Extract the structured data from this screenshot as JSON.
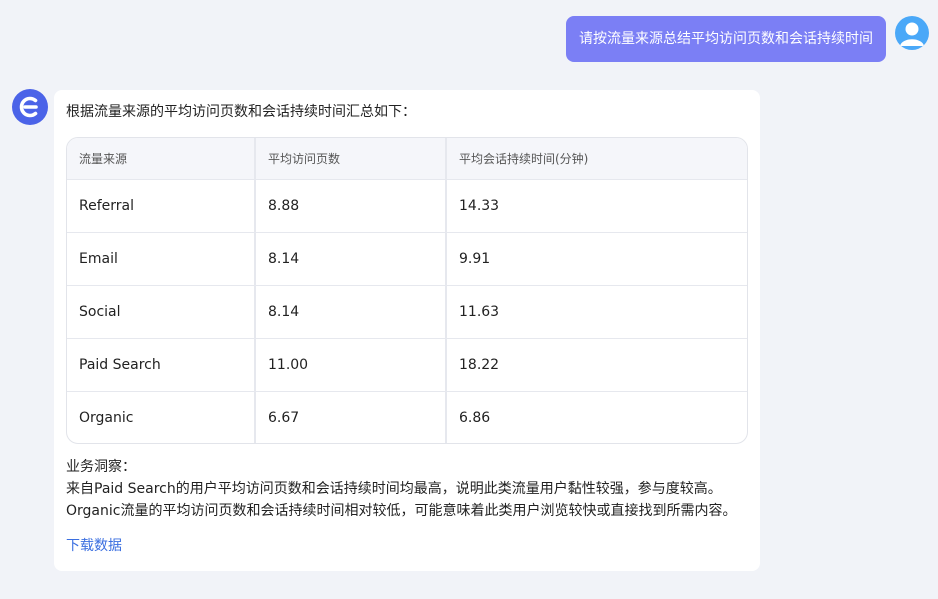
{
  "user_message": "请按流量来源总结平均访问页数和会话持续时间",
  "assistant": {
    "intro": "根据流量来源的平均访问页数和会话持续时间汇总如下：",
    "table": {
      "headers": [
        "流量来源",
        "平均访问页数",
        "平均会话持续时间(分钟)"
      ],
      "rows": [
        [
          "Referral",
          "8.88",
          "14.33"
        ],
        [
          "Email",
          "8.14",
          "9.91"
        ],
        [
          "Social",
          "8.14",
          "11.63"
        ],
        [
          "Paid Search",
          "11.00",
          "18.22"
        ],
        [
          "Organic",
          "6.67",
          "6.86"
        ]
      ]
    },
    "insights_title": "业务洞察：",
    "insights": [
      "来自Paid Search的用户平均访问页数和会话持续时间均最高，说明此类流量用户黏性较强，参与度较高。",
      "Organic流量的平均访问页数和会话持续时间相对较低，可能意味着此类用户浏览较快或直接找到所需内容。"
    ],
    "download_label": "下载数据"
  },
  "icons": {
    "user_avatar": "user-avatar-icon",
    "bot_avatar": "bot-logo-icon"
  },
  "colors": {
    "user_bubble": "#7b7ff5",
    "user_avatar": "#4aa8f8",
    "bot_avatar": "#4b63e8",
    "link": "#3b6fe0"
  }
}
